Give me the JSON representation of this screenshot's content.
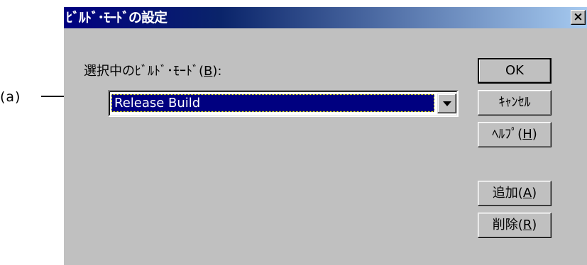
{
  "annotation": {
    "label": "(a)"
  },
  "dialog": {
    "title": "ﾋﾞﾙﾄﾞ･ﾓｰﾄﾞの設定",
    "close_glyph": "×",
    "field_label_prefix": "選択中のﾋﾞﾙﾄﾞ･ﾓｰﾄﾞ(",
    "field_label_mnemonic": "B",
    "field_label_suffix": "):",
    "combo_value": "Release Build",
    "buttons": {
      "ok": "OK",
      "cancel": "ｷｬﾝｾﾙ",
      "help_prefix": "ﾍﾙﾌﾟ(",
      "help_mnemonic": "H",
      "help_suffix": ")",
      "add_prefix": "追加(",
      "add_mnemonic": "A",
      "add_suffix": ")",
      "delete_prefix": "削除(",
      "delete_mnemonic": "R",
      "delete_suffix": ")"
    }
  },
  "colors": {
    "titlebar": "#000080",
    "dialog_bg": "#c0c0c0",
    "selection_bg": "#000080"
  },
  "icons": {
    "close": "close-icon",
    "dropdown": "chevron-down-icon",
    "callout": "arrow-right-icon"
  }
}
